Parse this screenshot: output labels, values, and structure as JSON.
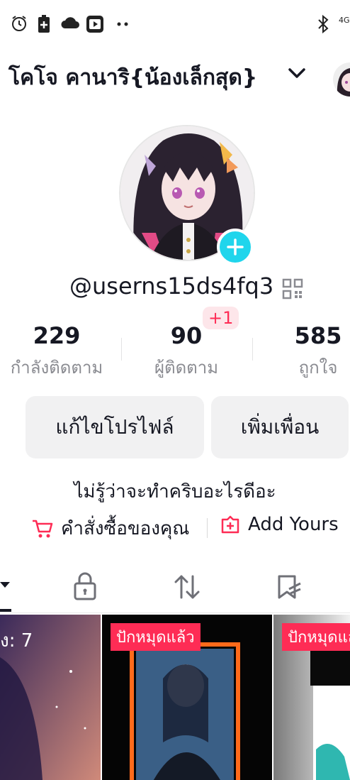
{
  "status_bar": {
    "network_label": "4G",
    "icons": [
      "alarm-icon",
      "battery-saver-icon",
      "cloud-icon",
      "app-notification-icon",
      "more-dots-icon",
      "bluetooth-icon",
      "signal-icon"
    ]
  },
  "header": {
    "account_name": "โคโจ คานาริ{น้องเล็กสุด}",
    "chevron_icon": "chevron-down-icon"
  },
  "profile": {
    "handle": "@userns15ds4fq3",
    "bio": "ไม่รู้ว่าจะทำคริบอะไรดีอะ"
  },
  "stats": [
    {
      "value": "229",
      "label": "กำลังติดตาม"
    },
    {
      "value": "90",
      "label": "ผู้ติดตาม",
      "badge": "+1"
    },
    {
      "value": "585",
      "label": "ถูกใจ"
    }
  ],
  "buttons": {
    "edit_profile": "แก้ไขโปรไฟล์",
    "add_friends": "เพิ่มเพื่อน"
  },
  "links": {
    "orders": "คำสั่งซื้อของคุณ",
    "add_yours": "Add Yours"
  },
  "tabs": [
    "videos-tab",
    "private-tab",
    "reposts-tab",
    "saved-tab"
  ],
  "grid": {
    "item1_text": "ง: 7",
    "item2_tag": "ปักหมุดแล้ว",
    "item3_tag": "ปักหมุดแล้"
  },
  "colors": {
    "accent_red": "#fe2c55",
    "plus_cyan": "#20d5ec",
    "secondary_text": "#8a8b91",
    "button_bg": "#f1f1f2"
  }
}
